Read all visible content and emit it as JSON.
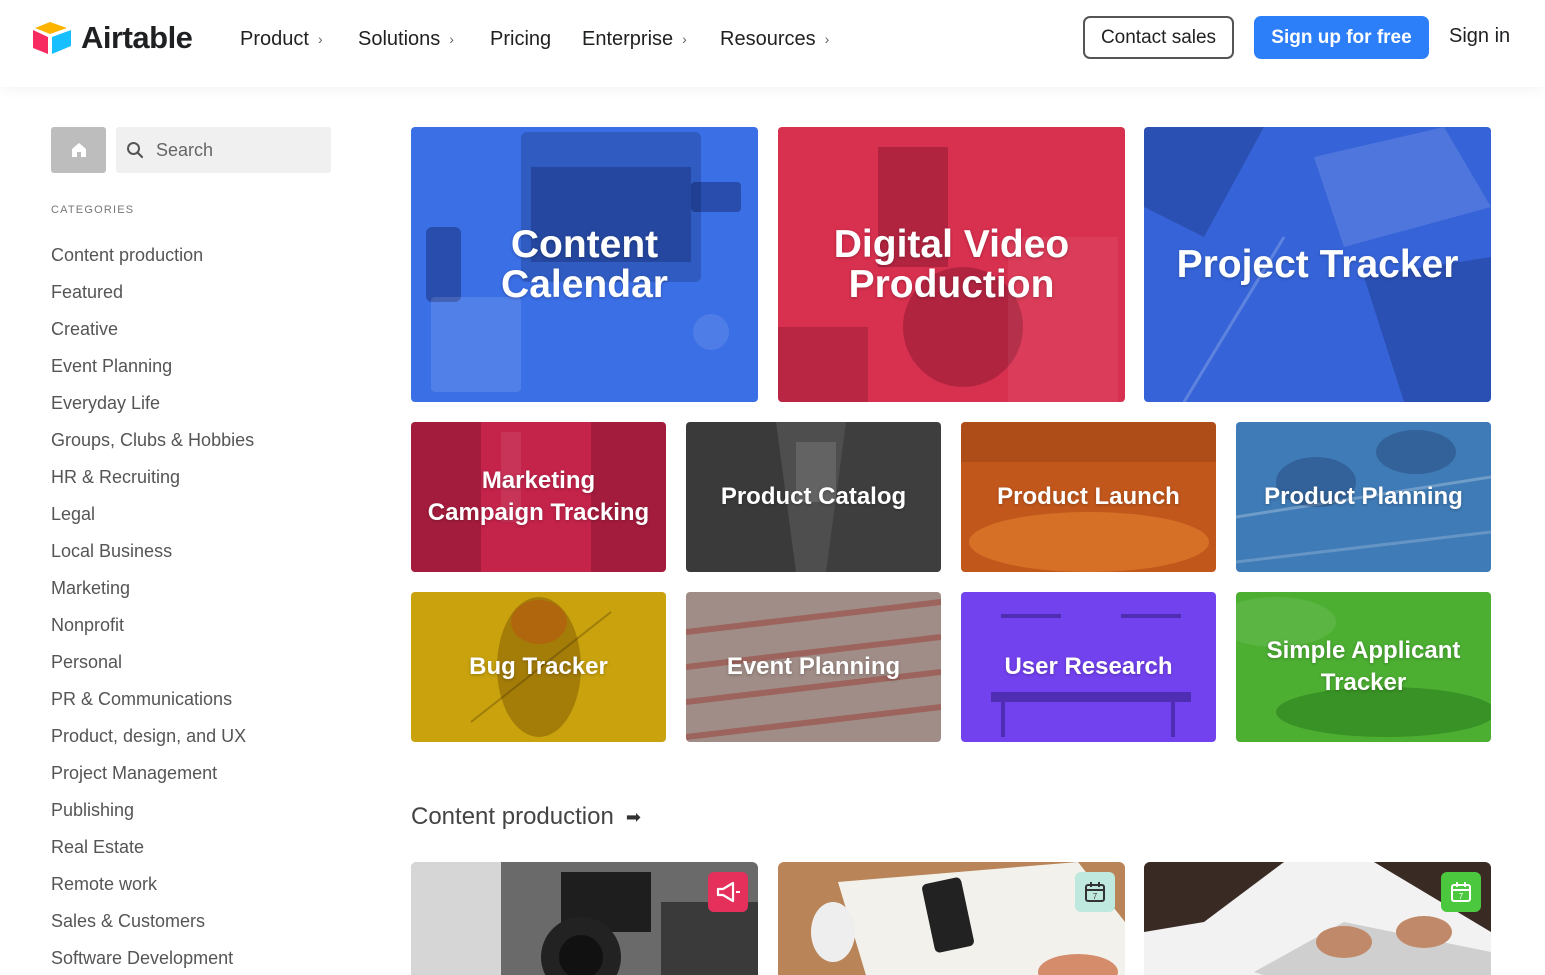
{
  "header": {
    "brand": "Airtable",
    "nav": [
      {
        "label": "Product",
        "chevron": "›"
      },
      {
        "label": "Solutions",
        "chevron": "›"
      },
      {
        "label": "Pricing",
        "chevron": ""
      },
      {
        "label": "Enterprise",
        "chevron": "›"
      },
      {
        "label": "Resources",
        "chevron": "›"
      }
    ],
    "contact_sales": "Contact sales",
    "sign_up": "Sign up for free",
    "sign_in": "Sign in"
  },
  "sidebar": {
    "search_placeholder": "Search",
    "categories_title": "CATEGORIES",
    "categories": [
      "Content production",
      "Featured",
      "Creative",
      "Event Planning",
      "Everyday Life",
      "Groups, Clubs & Hobbies",
      "HR & Recruiting",
      "Legal",
      "Local Business",
      "Marketing",
      "Nonprofit",
      "Personal",
      "PR & Communications",
      "Product, design, and UX",
      "Project Management",
      "Publishing",
      "Real Estate",
      "Remote work",
      "Sales & Customers",
      "Software Development"
    ]
  },
  "featured": {
    "large": [
      {
        "line1": "Content",
        "line2": "Calendar",
        "color": "#3b6fe6"
      },
      {
        "line1": "Digital Video",
        "line2": "Production",
        "color": "#d8304f"
      },
      {
        "line1": "Project Tracker",
        "line2": "",
        "color": "#3664d8"
      }
    ],
    "small": [
      {
        "line1": "Marketing",
        "line2": "Campaign Tracking",
        "color": "#c4234a"
      },
      {
        "line1": "Product Catalog",
        "line2": "",
        "color": "#4e4e4e"
      },
      {
        "line1": "Product Launch",
        "line2": "",
        "color": "#c2571c"
      },
      {
        "line1": "Product Planning",
        "line2": "",
        "color": "#3f7bb6"
      },
      {
        "line1": "Bug Tracker",
        "line2": "",
        "color": "#c9a20e"
      },
      {
        "line1": "Event Planning",
        "line2": "",
        "color": "#a18d87"
      },
      {
        "line1": "User Research",
        "line2": "",
        "color": "#7342ef"
      },
      {
        "line1": "Simple Applicant",
        "line2": "Tracker",
        "color": "#4caf32"
      }
    ]
  },
  "section": {
    "title": "Content production",
    "arrow": "➡",
    "cards": [
      {
        "icon": "megaphone-icon",
        "icon_color": "#e4305a",
        "bg": "#5a5a5a"
      },
      {
        "icon": "calendar-icon",
        "icon_color": "#bfe9de",
        "bg": "#c9a07a"
      },
      {
        "icon": "calendar-icon",
        "icon_color": "#4cc83f",
        "bg": "#e8e8e8"
      }
    ]
  }
}
